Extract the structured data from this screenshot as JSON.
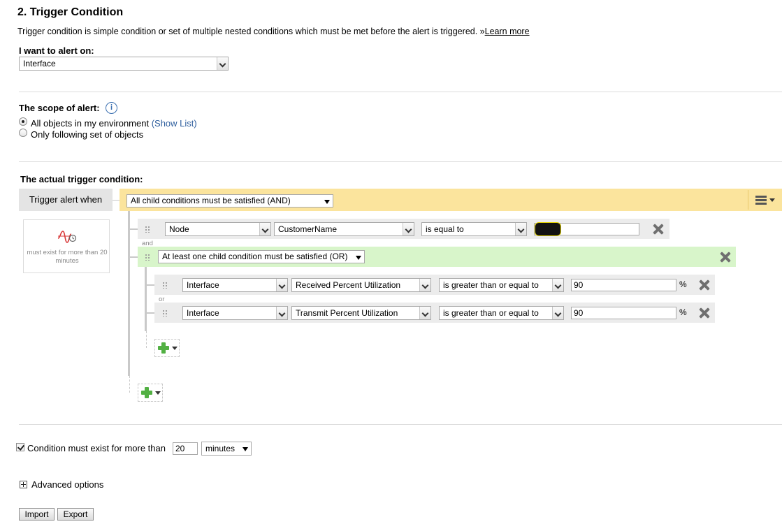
{
  "header": {
    "title": "2. Trigger Condition",
    "description": "Trigger condition is simple condition or set of multiple nested conditions which must be met before the alert is triggered. »",
    "learn_more": "Learn more"
  },
  "alert_on": {
    "label": "I want to alert on:",
    "value": "Interface"
  },
  "scope": {
    "label": "The scope of alert:",
    "option_all": "All objects in my environment",
    "show_list": "(Show List)",
    "option_following": "Only following set of objects",
    "selected": "all"
  },
  "trigger": {
    "label": "The actual trigger condition:",
    "trigger_when": "Trigger alert when",
    "root_logic": "All child conditions must be satisfied (AND)",
    "summary": "must exist for more than 20 minutes",
    "condition1": {
      "object": "Node",
      "field": "CustomerName",
      "operator": "is equal to",
      "value": ""
    },
    "and_label": "and",
    "group_logic": "At least one child condition must be satisfied (OR)",
    "or_label": "or",
    "sub1": {
      "object": "Interface",
      "field": "Received Percent Utilization",
      "operator": "is greater than or equal to",
      "value": "90",
      "unit": "%"
    },
    "sub2": {
      "object": "Interface",
      "field": "Transmit Percent Utilization",
      "operator": "is greater than or equal to",
      "value": "90",
      "unit": "%"
    }
  },
  "duration": {
    "checked": true,
    "label": "Condition must exist for more than",
    "value": "20",
    "unit": "minutes"
  },
  "advanced": {
    "label": "Advanced options"
  },
  "buttons": {
    "import": "Import",
    "export": "Export"
  },
  "colors": {
    "and_group": "#fbe49d",
    "or_group": "#d8f5ca",
    "row": "#ececec",
    "add": "#52b043"
  }
}
